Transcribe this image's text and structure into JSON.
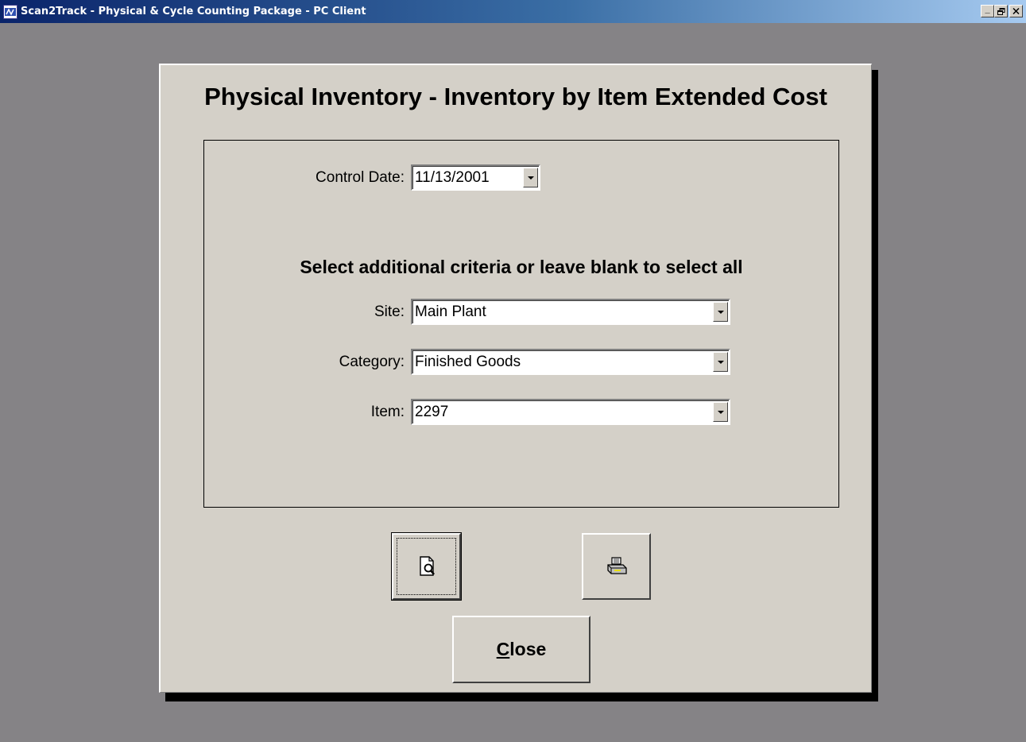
{
  "window": {
    "title": "Scan2Track - Physical & Cycle Counting Package - PC Client",
    "controls": {
      "minimize": "_",
      "restore": "§",
      "close": "×"
    }
  },
  "dialog": {
    "title": "Physical Inventory - Inventory by Item Extended Cost",
    "control_date": {
      "label": "Control Date:",
      "value": "11/13/2001"
    },
    "criteria_heading": "Select additional criteria or leave blank to select all",
    "site": {
      "label": "Site:",
      "value": "Main Plant"
    },
    "category": {
      "label": "Category:",
      "value": "Finished Goods"
    },
    "item": {
      "label": "Item:",
      "value": "2297"
    },
    "buttons": {
      "preview_icon": "print-preview-icon",
      "print_icon": "printer-icon",
      "close_first": "C",
      "close_rest": "lose"
    }
  }
}
